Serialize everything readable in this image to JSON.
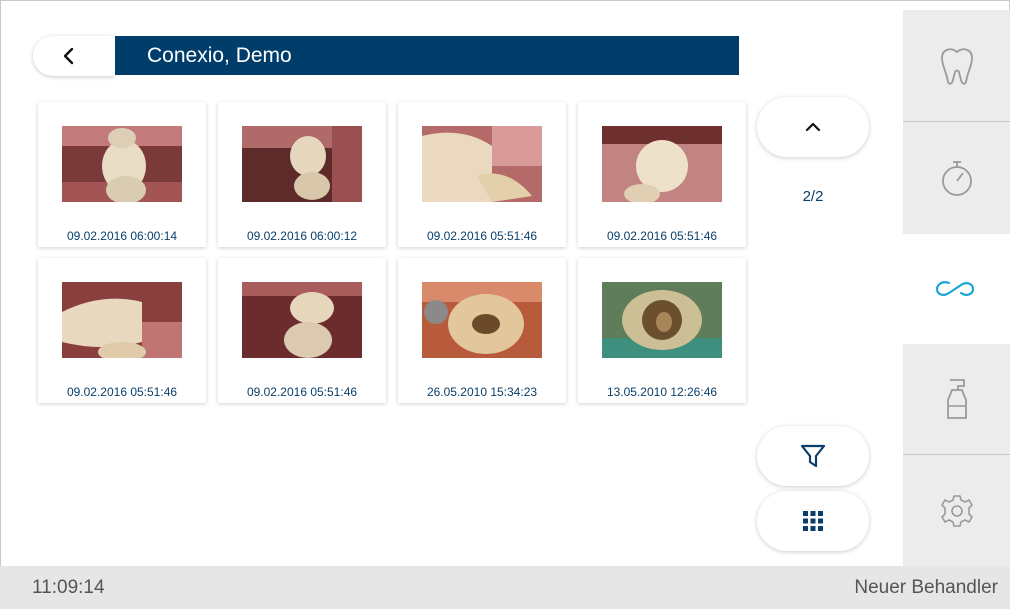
{
  "header": {
    "title": "Conexio, Demo"
  },
  "gallery": {
    "items": [
      {
        "timestamp": "09.02.2016 06:00:14"
      },
      {
        "timestamp": "09.02.2016 06:00:12"
      },
      {
        "timestamp": "09.02.2016 05:51:46"
      },
      {
        "timestamp": "09.02.2016 05:51:46"
      },
      {
        "timestamp": "09.02.2016 05:51:46"
      },
      {
        "timestamp": "09.02.2016 05:51:46"
      },
      {
        "timestamp": "26.05.2010 15:34:23"
      },
      {
        "timestamp": "13.05.2010 12:26:46"
      }
    ]
  },
  "pager": {
    "indicator": "2/2"
  },
  "sidebar": {
    "items": [
      {
        "icon": "tooth-icon",
        "active": false
      },
      {
        "icon": "stopwatch-icon",
        "active": false
      },
      {
        "icon": "infinity-icon",
        "active": true
      },
      {
        "icon": "spray-bottle-icon",
        "active": false
      },
      {
        "icon": "gear-icon",
        "active": false
      }
    ]
  },
  "status": {
    "time": "11:09:14",
    "user": "Neuer Behandler"
  },
  "colors": {
    "brand": "#003d6b",
    "accent": "#1aa7d6",
    "sidebar_bg": "#ececec",
    "status_bg": "#e6e6e6"
  }
}
